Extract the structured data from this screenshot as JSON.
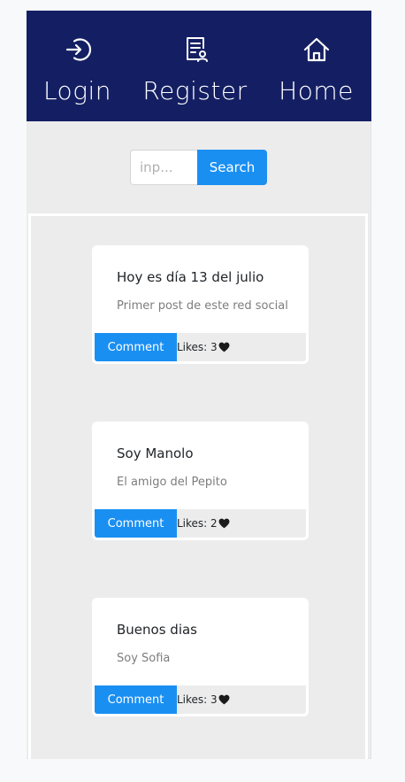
{
  "nav": {
    "items": [
      {
        "label": "Login",
        "icon": "login-icon"
      },
      {
        "label": "Register",
        "icon": "register-icon"
      },
      {
        "label": "Home",
        "icon": "home-icon"
      }
    ],
    "background": "#141f63"
  },
  "search": {
    "placeholder": "inp...",
    "value": "",
    "button_label": "Search"
  },
  "posts": [
    {
      "title": "Hoy es día 13 del julio",
      "body": "Primer post de este red social",
      "comment_label": "Comment",
      "likes_label": "Likes:",
      "likes": "3"
    },
    {
      "title": "Soy Manolo",
      "body": "El amigo del Pepito",
      "comment_label": "Comment",
      "likes_label": "Likes:",
      "likes": "2"
    },
    {
      "title": "Buenos dias",
      "body": "Soy Sofia",
      "comment_label": "Comment",
      "likes_label": "Likes:",
      "likes": "3"
    }
  ],
  "colors": {
    "accent": "#1a8ff2",
    "nav": "#141f63",
    "background": "#ececec"
  }
}
